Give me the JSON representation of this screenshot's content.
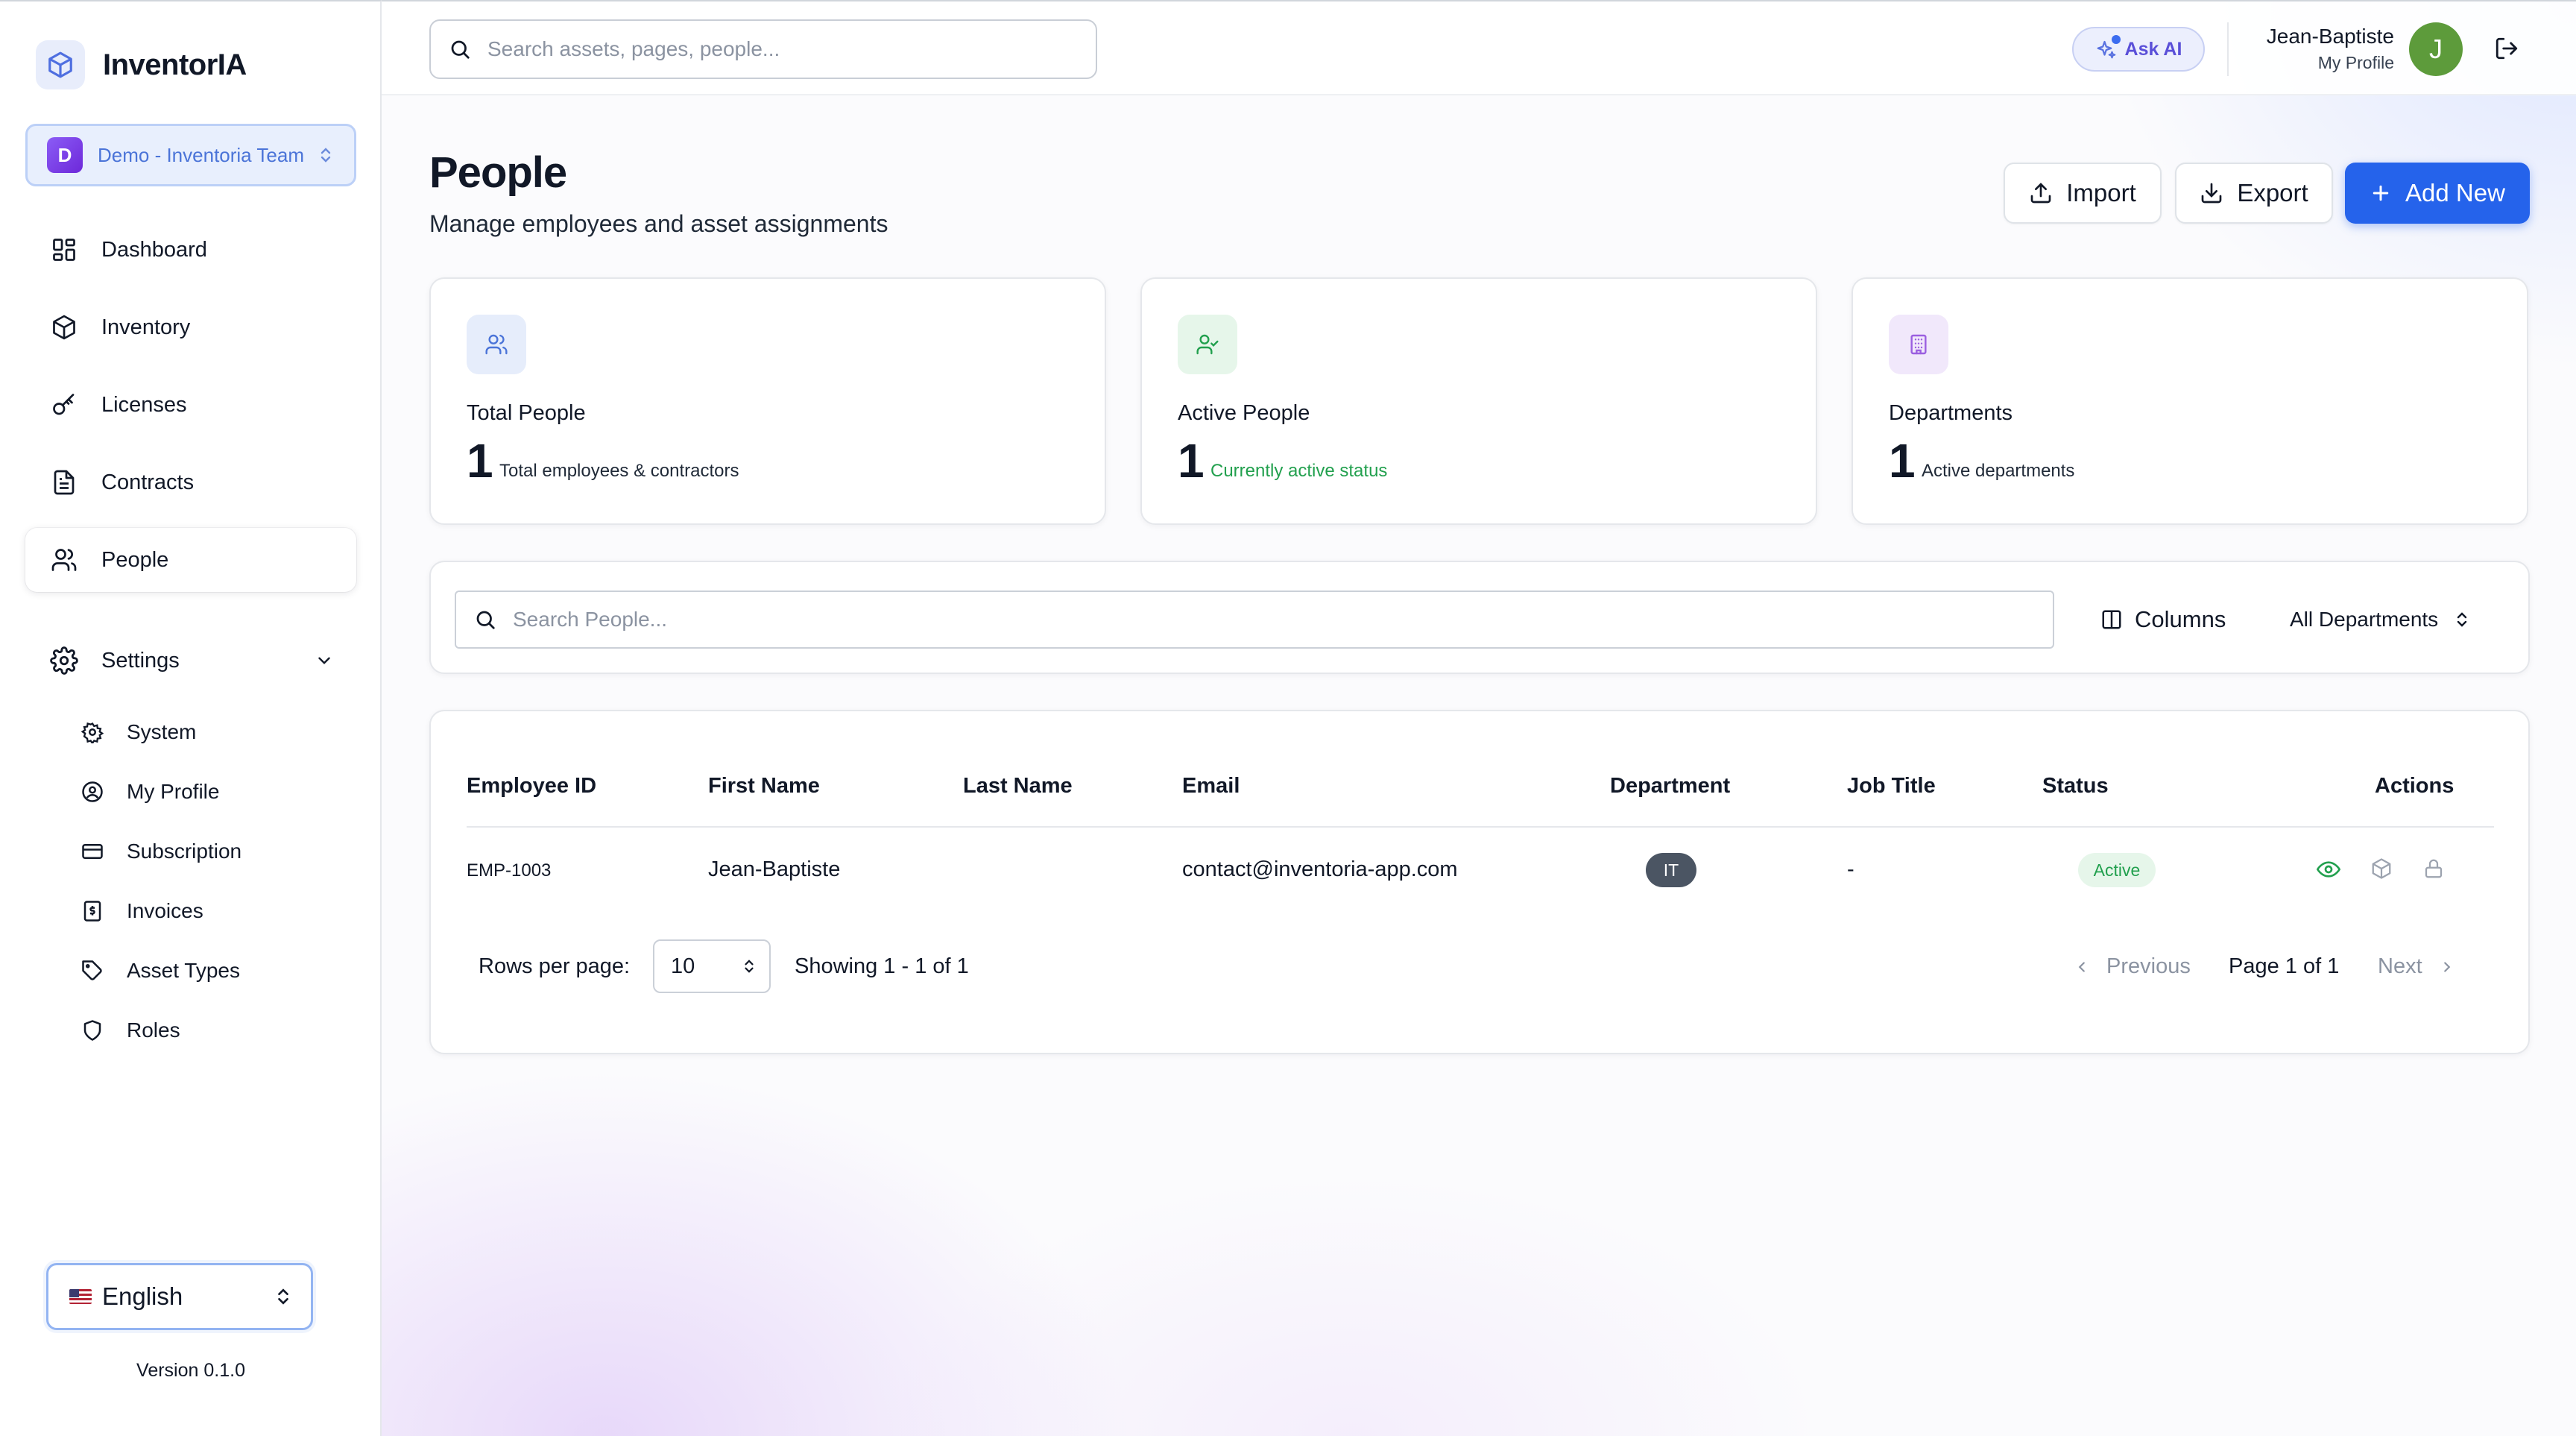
{
  "app": {
    "name": "InventorIA",
    "version": "Version 0.1.0"
  },
  "team": {
    "initial": "D",
    "name": "Demo - Inventoria Team"
  },
  "sidebar": {
    "items": [
      {
        "label": "Dashboard",
        "icon": "dashboard-icon"
      },
      {
        "label": "Inventory",
        "icon": "box-icon"
      },
      {
        "label": "Licenses",
        "icon": "key-icon"
      },
      {
        "label": "Contracts",
        "icon": "document-icon"
      },
      {
        "label": "People",
        "icon": "users-icon",
        "active": true
      }
    ],
    "settings": {
      "label": "Settings",
      "items": [
        {
          "label": "System",
          "icon": "gear-icon"
        },
        {
          "label": "My Profile",
          "icon": "user-circle-icon"
        },
        {
          "label": "Subscription",
          "icon": "credit-card-icon"
        },
        {
          "label": "Invoices",
          "icon": "invoice-icon"
        },
        {
          "label": "Asset Types",
          "icon": "tag-icon"
        },
        {
          "label": "Roles",
          "icon": "shield-icon"
        }
      ]
    },
    "language": "English"
  },
  "topbar": {
    "search_placeholder": "Search assets, pages, people...",
    "ask_ai": "Ask AI",
    "user_name": "Jean-Baptiste",
    "user_link": "My Profile",
    "avatar_initial": "J"
  },
  "page": {
    "title": "People",
    "subtitle": "Manage employees and asset assignments",
    "buttons": {
      "import": "Import",
      "export": "Export",
      "add_new": "Add New"
    }
  },
  "stats": [
    {
      "label": "Total People",
      "value": "1",
      "desc": "Total employees & contractors"
    },
    {
      "label": "Active People",
      "value": "1",
      "desc": "Currently active status"
    },
    {
      "label": "Departments",
      "value": "1",
      "desc": "Active departments"
    }
  ],
  "filters": {
    "search_placeholder": "Search People...",
    "columns": "Columns",
    "department": "All Departments"
  },
  "table": {
    "columns": [
      "Employee ID",
      "First Name",
      "Last Name",
      "Email",
      "Department",
      "Job Title",
      "Status",
      "Actions"
    ],
    "rows": [
      {
        "employee_id": "EMP-1003",
        "first_name": "Jean-Baptiste",
        "last_name": "",
        "email": "contact@inventoria-app.com",
        "department": "IT",
        "job_title": "-",
        "status": "Active"
      }
    ]
  },
  "pagination": {
    "rows_label": "Rows per page:",
    "rows_value": "10",
    "showing": "Showing 1 - 1 of 1",
    "previous": "Previous",
    "page": "Page 1 of 1",
    "next": "Next"
  },
  "colors": {
    "primary": "#2563eb",
    "active_green": "#22a04e",
    "badge_dark": "#4b5563"
  }
}
